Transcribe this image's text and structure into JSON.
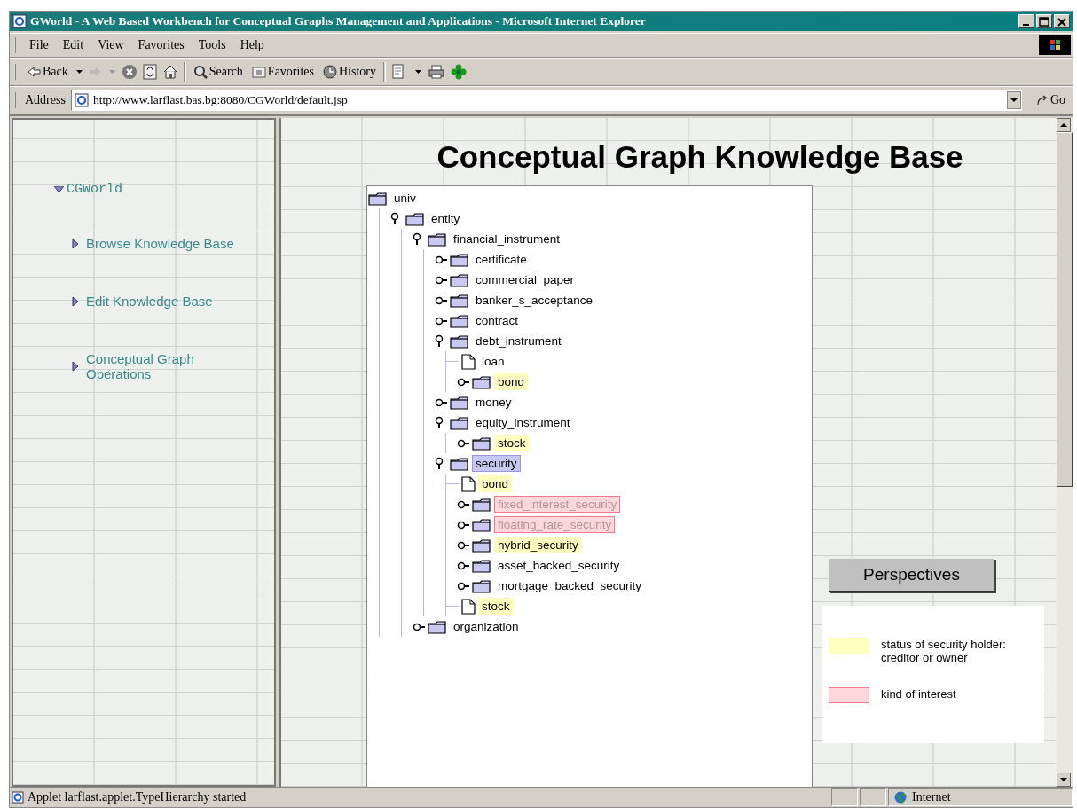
{
  "window": {
    "title": "GWorld - A Web Based Workbench for Conceptual Graphs Management and Applications - Microsoft Internet Explorer"
  },
  "menu": [
    "File",
    "Edit",
    "View",
    "Favorites",
    "Tools",
    "Help"
  ],
  "toolbar": [
    {
      "kind": "back",
      "label": "Back"
    },
    {
      "kind": "search",
      "label": "Search"
    },
    {
      "kind": "favorites",
      "label": "Favorites"
    },
    {
      "kind": "history",
      "label": "History"
    }
  ],
  "address": {
    "label": "Address",
    "value": "http://www.larflast.bas.bg:8080/CGWorld/default.jsp",
    "go": "Go"
  },
  "sidebar": {
    "title": "CGWorld",
    "expanded": true,
    "items": [
      {
        "label": "Browse Knowledge Base"
      },
      {
        "label": "Edit Knowledge Base"
      },
      {
        "label": "Conceptual Graph Operations"
      }
    ]
  },
  "page_title": "Conceptual Graph Knowledge Base",
  "tree": {
    "label": "univ",
    "kind": "folder",
    "children": [
      {
        "label": "entity",
        "kind": "folder",
        "expanded": true,
        "children": [
          {
            "label": "financial_instrument",
            "kind": "folder",
            "expanded": true,
            "children": [
              {
                "label": "certificate",
                "kind": "folder",
                "expanded": false
              },
              {
                "label": "commercial_paper",
                "kind": "folder",
                "expanded": false
              },
              {
                "label": "banker_s_acceptance",
                "kind": "folder",
                "expanded": false
              },
              {
                "label": "contract",
                "kind": "folder",
                "expanded": false
              },
              {
                "label": "debt_instrument",
                "kind": "folder",
                "expanded": true,
                "children": [
                  {
                    "label": "loan",
                    "kind": "leaf"
                  },
                  {
                    "label": "bond",
                    "kind": "folder",
                    "expanded": false,
                    "color": "#ffffc0",
                    "outlined": false
                  }
                ]
              },
              {
                "label": "money",
                "kind": "folder",
                "expanded": false
              },
              {
                "label": "equity_instrument",
                "kind": "folder",
                "expanded": true,
                "children": [
                  {
                    "label": "stock",
                    "kind": "folder",
                    "expanded": false,
                    "color": "#ffffc0",
                    "outlined": false
                  }
                ]
              },
              {
                "label": "security",
                "kind": "folder",
                "expanded": true,
                "selected": true,
                "children": [
                  {
                    "label": "bond",
                    "kind": "leaf",
                    "color": "#ffffc0",
                    "outlined": false
                  },
                  {
                    "label": "fixed_interest_security",
                    "kind": "folder",
                    "expanded": false,
                    "color": "#fcd8dc",
                    "outlined": true
                  },
                  {
                    "label": "floating_rate_security",
                    "kind": "folder",
                    "expanded": false,
                    "color": "#fcd8dc",
                    "outlined": true
                  },
                  {
                    "label": "hybrid_security",
                    "kind": "folder",
                    "expanded": false,
                    "color": "#ffffc0",
                    "outlined": false
                  },
                  {
                    "label": "asset_backed_security",
                    "kind": "folder",
                    "expanded": false
                  },
                  {
                    "label": "mortgage_backed_security",
                    "kind": "folder",
                    "expanded": false
                  },
                  {
                    "label": "stock",
                    "kind": "leaf",
                    "color": "#ffffc0",
                    "outlined": false
                  }
                ]
              }
            ]
          },
          {
            "label": "organization",
            "kind": "folder",
            "expanded": false
          }
        ]
      }
    ]
  },
  "perspectives_button": "Perspectives",
  "legend": [
    {
      "color": "#ffffc0",
      "outlined": false,
      "label": "status of security holder: creditor or owner"
    },
    {
      "color": "#fcd8dc",
      "outlined": true,
      "label": "kind of interest"
    }
  ],
  "status_bar": {
    "message": "Applet larflast.applet.TypeHierarchy started",
    "zone": "Internet"
  }
}
